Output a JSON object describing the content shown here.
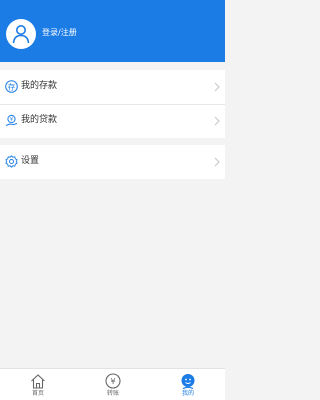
{
  "header": {
    "login_label": "登录/注册",
    "avatar_icon": "user-icon"
  },
  "menu": {
    "deposits": {
      "label": "我的存款",
      "icon": "deposit-icon"
    },
    "loans": {
      "label": "我的贷款",
      "icon": "loan-icon"
    },
    "settings": {
      "label": "设置",
      "icon": "gear-icon"
    }
  },
  "tabbar": {
    "tabs": [
      {
        "label": "首页",
        "icon": "home-icon",
        "active": false
      },
      {
        "label": "转账",
        "icon": "yen-icon",
        "active": false
      },
      {
        "label": "我的",
        "icon": "user-icon",
        "active": true
      }
    ]
  },
  "colors": {
    "accent": "#1c7ce6",
    "background": "#f3f3f3"
  }
}
